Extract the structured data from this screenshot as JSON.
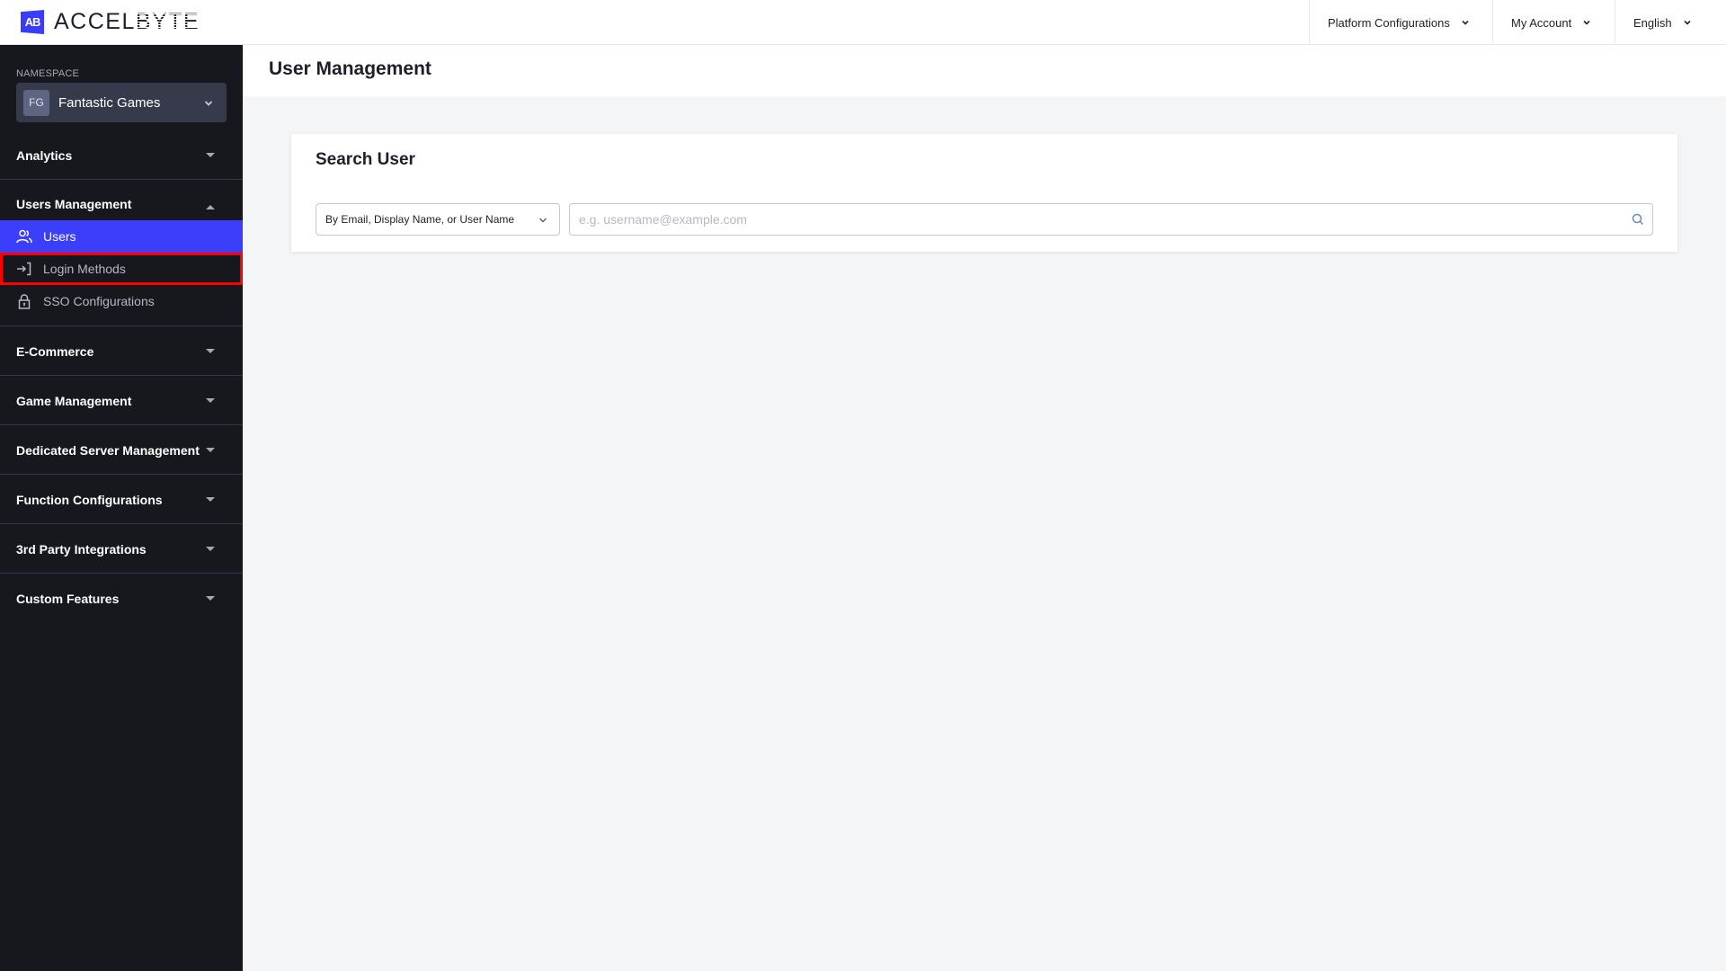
{
  "brand": {
    "logo_mark": "AB",
    "name_part1": "ACCEL",
    "name_part2": "BYTE",
    "accent_color": "#3b3efb"
  },
  "topnav": {
    "items": [
      {
        "label": "Platform Configurations",
        "icon": "chevron-down-icon"
      },
      {
        "label": "My Account",
        "icon": "chevron-down-icon"
      },
      {
        "label": "English",
        "icon": "chevron-down-icon"
      }
    ]
  },
  "sidebar": {
    "namespace_label": "NAMESPACE",
    "namespace": {
      "initials": "FG",
      "name": "Fantastic Games"
    },
    "sections": [
      {
        "label": "Analytics",
        "expanded": false
      },
      {
        "label": "Users Management",
        "expanded": true,
        "items": [
          {
            "label": "Users",
            "icon": "users-icon",
            "active": true
          },
          {
            "label": "Login Methods",
            "icon": "login-icon",
            "highlighted": true
          },
          {
            "label": "SSO Configurations",
            "icon": "lock-icon"
          }
        ]
      },
      {
        "label": "E-Commerce",
        "expanded": false
      },
      {
        "label": "Game Management",
        "expanded": false
      },
      {
        "label": "Dedicated Server Management",
        "expanded": false
      },
      {
        "label": "Function Configurations",
        "expanded": false
      },
      {
        "label": "3rd Party Integrations",
        "expanded": false
      },
      {
        "label": "Custom Features",
        "expanded": false
      }
    ]
  },
  "main": {
    "page_title": "User Management",
    "search_card": {
      "title": "Search User",
      "search_type_selected": "By Email, Display Name, or User Name",
      "search_value": "",
      "search_placeholder": "e.g. username@example.com"
    }
  }
}
